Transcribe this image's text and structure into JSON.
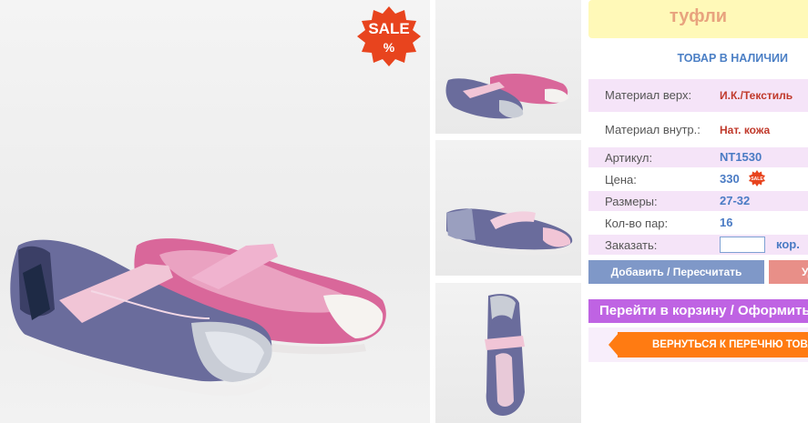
{
  "product": {
    "title": "туфли",
    "stock_status": "ТОВАР В НАЛИЧИИ",
    "sale_badge": "SALE",
    "sale_badge_symbol": "%",
    "small_sale_badge": "SALE"
  },
  "specs": [
    {
      "label": "Материал верх:",
      "value": "И.К./Текстиль"
    },
    {
      "label": "Материал внутр.:",
      "value": "Нат. кожа"
    },
    {
      "label": "Артикул:",
      "value": "NT1530"
    },
    {
      "label": "Цена:",
      "value": "330"
    },
    {
      "label": "Размеры:",
      "value": "27-32"
    },
    {
      "label": "Кол-во пар:",
      "value": "16"
    },
    {
      "label": "Заказать:",
      "value": ""
    }
  ],
  "order": {
    "unit": "кор."
  },
  "buttons": {
    "add": "Добавить / Пересчитать",
    "remove": "Удалить",
    "cart": "Перейти в корзину / Оформить заказ",
    "back": "ВЕРНУТЬСЯ К ПЕРЕЧНЮ ТОВАРОВ"
  },
  "colors": {
    "title_bg": "#fff9b8",
    "title_text": "#e8a37e",
    "row_pink": "#f5e4f8",
    "value_blue": "#4a7bc4",
    "value_red": "#c0392b",
    "add_button": "#7f98c8",
    "remove_button": "#e88f88",
    "cart_button": "#bf63e3",
    "back_button": "#ff7b12",
    "sale_red": "#e8441e"
  }
}
